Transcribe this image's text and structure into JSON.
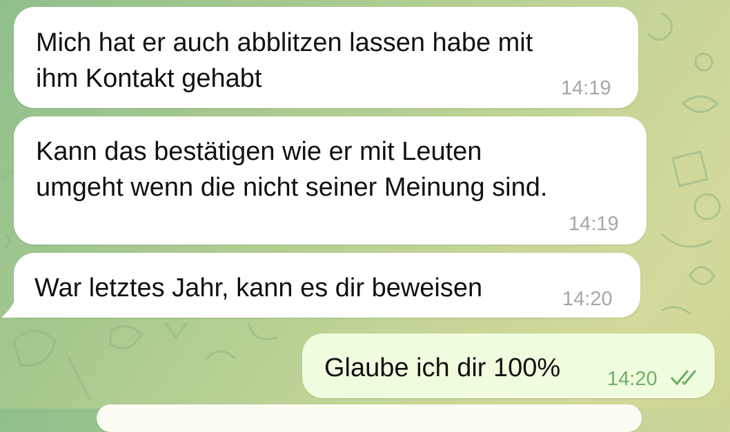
{
  "chat": {
    "messages": [
      {
        "direction": "incoming",
        "lines": [
          "Mich hat er auch abblitzen lassen habe mit",
          "ihm Kontakt gehabt"
        ],
        "time": "14:19"
      },
      {
        "direction": "incoming",
        "lines": [
          "Kann das bestätigen wie er mit Leuten",
          "umgeht wenn die nicht seiner Meinung sind."
        ],
        "time": "14:19"
      },
      {
        "direction": "incoming",
        "lines": [
          "War letztes Jahr, kann es dir beweisen"
        ],
        "time": "14:20"
      },
      {
        "direction": "outgoing",
        "lines": [
          "Glaube ich dir 100%"
        ],
        "time": "14:20",
        "status": "read"
      }
    ]
  },
  "colors": {
    "incoming_bubble": "#ffffff",
    "outgoing_bubble": "#effdde",
    "outgoing_meta": "#6fae68",
    "incoming_meta": "#a3a7ab"
  },
  "icons": {
    "read_status": "double-check-icon"
  }
}
